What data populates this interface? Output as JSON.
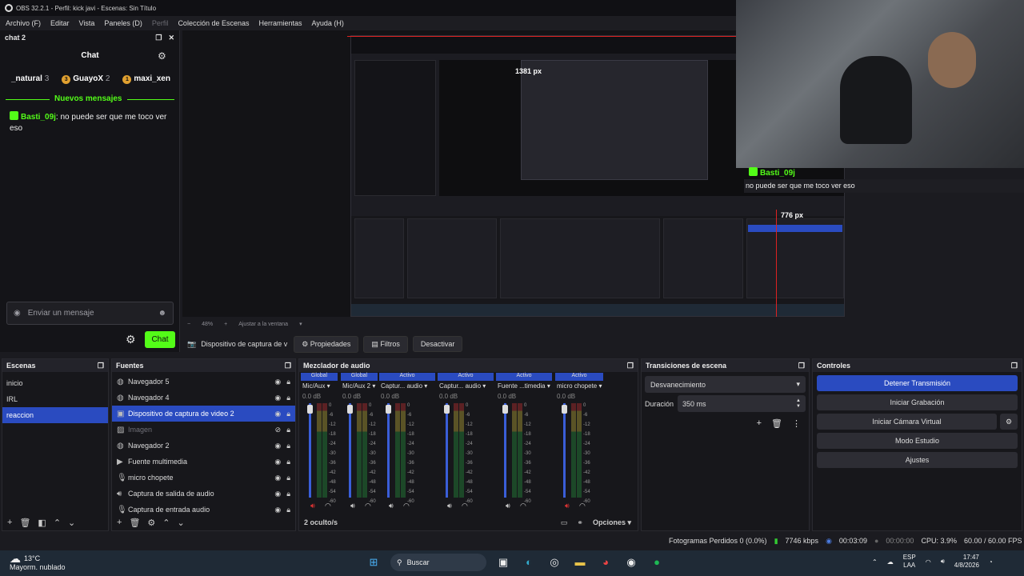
{
  "window": {
    "title": "OBS 32.2.1 - Perfil: kick javi - Escenas: Sin Título"
  },
  "menu": [
    "Archivo (F)",
    "Editar",
    "Vista",
    "Paneles (D)",
    "Perfil",
    "Colección de Escenas",
    "Herramientas",
    "Ayuda (H)"
  ],
  "chat": {
    "dock_title": "chat 2",
    "title": "Chat",
    "leaders": [
      {
        "name": "_natural",
        "count": "3"
      },
      {
        "rank": "3",
        "name": "GuayoX",
        "count": "2"
      },
      {
        "rank": "1",
        "name": "maxi_xen",
        "count": ""
      }
    ],
    "new_messages": "Nuevos mensajes",
    "user": "Basti_09j",
    "message": "no puede ser que me toco ver eso",
    "input_placeholder": "Enviar un mensaje",
    "send": "Chat"
  },
  "overlay": {
    "user": "Basti_09j",
    "message": "no puede ser que me toco ver eso",
    "px_a": "1381 px",
    "px_b": "776 px"
  },
  "scale": {
    "zoom": "48%",
    "fit": "Ajustar a la ventana"
  },
  "context": {
    "source": "Dispositivo de captura de v",
    "props": "Propiedades",
    "filters": "Filtros",
    "deactivate": "Desactivar"
  },
  "scenes": {
    "title": "Escenas",
    "items": [
      "inicio",
      "IRL",
      "reaccion"
    ],
    "selected": 2
  },
  "sources": {
    "title": "Fuentes",
    "items": [
      {
        "name": "Navegador 5",
        "icon": "globe"
      },
      {
        "name": "Navegador 4",
        "icon": "globe"
      },
      {
        "name": "Dispositivo de captura de video 2",
        "icon": "camera",
        "selected": true
      },
      {
        "name": "Imagen",
        "icon": "image",
        "hidden": true
      },
      {
        "name": "Navegador 2",
        "icon": "globe"
      },
      {
        "name": "Fuente multimedia",
        "icon": "play"
      },
      {
        "name": "micro chopete",
        "icon": "mic"
      },
      {
        "name": "Captura de salida de audio",
        "icon": "speaker"
      },
      {
        "name": "Captura de entrada audio",
        "icon": "mic"
      }
    ]
  },
  "mixer": {
    "title": "Mezclador de audio",
    "hidden": "2 oculto/s",
    "options": "Opciones",
    "channels": [
      {
        "tag": "Global",
        "name": "Mic/Aux",
        "db": "0.0 dB"
      },
      {
        "tag": "Global",
        "name": "Mic/Aux 2",
        "db": "0.0 dB"
      },
      {
        "tag": "Activo",
        "name": "Captur... audio",
        "db": "0.0 dB"
      },
      {
        "tag": "Activo",
        "name": "Captur... audio",
        "db": "0.0 dB"
      },
      {
        "tag": "Activo",
        "name": "Fuente ...timedia",
        "db": "0.0 dB"
      },
      {
        "tag": "Activo",
        "name": "micro chopete",
        "db": "0.0 dB"
      }
    ],
    "ticks": [
      "0",
      "-6",
      "-12",
      "-18",
      "-24",
      "-30",
      "-36",
      "-42",
      "-48",
      "-54",
      "-60"
    ]
  },
  "transitions": {
    "title": "Transiciones de escena",
    "type": "Desvanecimiento",
    "duration_label": "Duración",
    "duration": "350 ms"
  },
  "controls": {
    "title": "Controles",
    "buttons": [
      "Detener Transmisión",
      "Iniciar Grabación",
      "Iniciar Cámara Virtual",
      "Modo Estudio",
      "Ajustes"
    ]
  },
  "status": {
    "dropped": "Fotogramas Perdidos 0 (0.0%)",
    "kbps": "7746 kbps",
    "stream_time": "00:03:09",
    "rec_time": "00:00:00",
    "cpu": "CPU: 3.9%",
    "fps": "60.00 / 60.00 FPS"
  },
  "taskbar": {
    "temp": "13°C",
    "weather": "Mayorm. nublado",
    "search": "Buscar",
    "lang": "ESP",
    "lang2": "LAA",
    "time": "17:47",
    "date": "4/8/2026"
  }
}
